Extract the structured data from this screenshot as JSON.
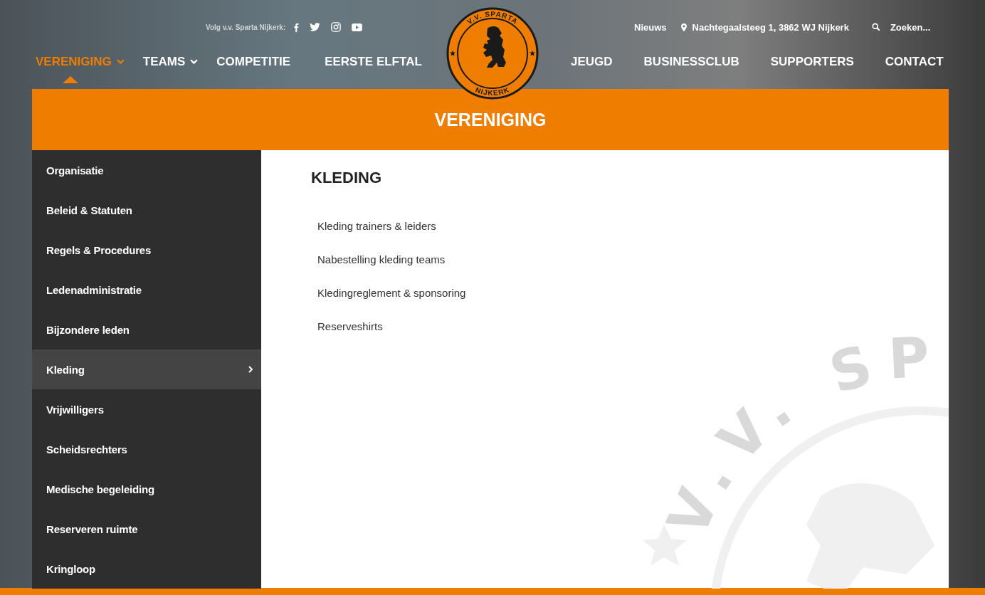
{
  "header": {
    "follow_label": "Volg v.v. Sparta Nijkerk:",
    "social": [
      {
        "kind": "facebook"
      },
      {
        "kind": "twitter"
      },
      {
        "kind": "instagram"
      },
      {
        "kind": "youtube"
      }
    ],
    "news_link": "Nieuws",
    "address": "Nachtegaalsteeg 1, 3862 WJ Nijkerk",
    "search": {
      "placeholder": "Zoeken..."
    },
    "logo": {
      "top_text": "V.V. SPARTA",
      "bottom_text": "NIJKERK"
    },
    "nav_left": [
      {
        "label": "VERENIGING",
        "selected": true,
        "dropdown": true
      },
      {
        "label": "TEAMS",
        "selected": false,
        "dropdown": true
      },
      {
        "label": "COMPETITIE",
        "selected": false,
        "dropdown": false
      },
      {
        "label": "EERSTE ELFTAL",
        "selected": false,
        "dropdown": false
      }
    ],
    "nav_right": [
      {
        "label": "JEUGD",
        "selected": false,
        "dropdown": false
      },
      {
        "label": "BUSINESSCLUB",
        "selected": false,
        "dropdown": false
      },
      {
        "label": "SUPPORTERS",
        "selected": false,
        "dropdown": false
      },
      {
        "label": "CONTACT",
        "selected": false,
        "dropdown": false
      }
    ]
  },
  "menu": {
    "title": "VERENIGING",
    "sidebar": [
      {
        "label": "Organisatie",
        "selected": false
      },
      {
        "label": "Beleid & Statuten",
        "selected": false
      },
      {
        "label": "Regels & Procedures",
        "selected": false
      },
      {
        "label": "Ledenadministratie",
        "selected": false
      },
      {
        "label": "Bijzondere leden",
        "selected": false
      },
      {
        "label": "Kleding",
        "selected": true
      },
      {
        "label": "Vrijwilligers",
        "selected": false
      },
      {
        "label": "Scheidsrechters",
        "selected": false
      },
      {
        "label": "Medische begeleiding",
        "selected": false
      },
      {
        "label": "Reserveren ruimte",
        "selected": false
      },
      {
        "label": "Kringloop",
        "selected": false
      }
    ],
    "content": {
      "heading": "KLEDING",
      "links": [
        "Kleding trainers & leiders",
        "Nabestelling kleding teams",
        "Kledingreglement & sponsoring",
        "Reserveshirts"
      ],
      "emblem_text": "V.V. SP"
    }
  }
}
